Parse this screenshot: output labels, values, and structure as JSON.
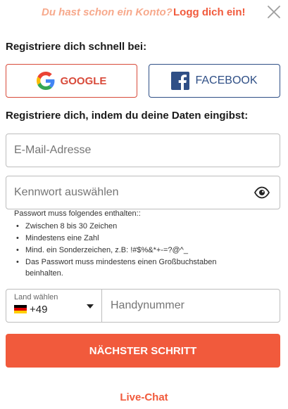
{
  "header": {
    "have_account": "Du hast schon ein Konto?",
    "login_link": "Logg dich ein!",
    "close_icon": "close-icon"
  },
  "social": {
    "title": "Registriere dich schnell bei:",
    "google_label": "GOOGLE",
    "facebook_label": "FACEBOOK"
  },
  "form": {
    "title": "Registriere dich, indem du deine Daten eingibst:",
    "email_placeholder": "E-Mail-Adresse",
    "email_value": "",
    "password_placeholder": "Kennwort auswählen",
    "password_value": "",
    "password_rules_title": "Passwort muss folgendes enthalten::",
    "password_rules": [
      "Zwischen 8 bis 30 Zeichen",
      "Mindestens eine Zahl",
      "Mind. ein Sonderzeichen, z.B: !#$%&*+-=?@^_",
      "Das Passwort muss mindestens einen Großbuchstaben beinhalten."
    ],
    "country_label": "Land wählen",
    "country_code": "+49",
    "phone_placeholder": "Handynummer",
    "phone_value": ""
  },
  "actions": {
    "next_label": "NÄCHSTER SCHRITT",
    "live_chat": "Live-Chat"
  },
  "colors": {
    "accent": "#f15a3c",
    "accent_light": "#f7a98c",
    "google_red": "#d84a3a",
    "facebook_blue": "#2f4f86",
    "border": "#bdbdbd"
  }
}
